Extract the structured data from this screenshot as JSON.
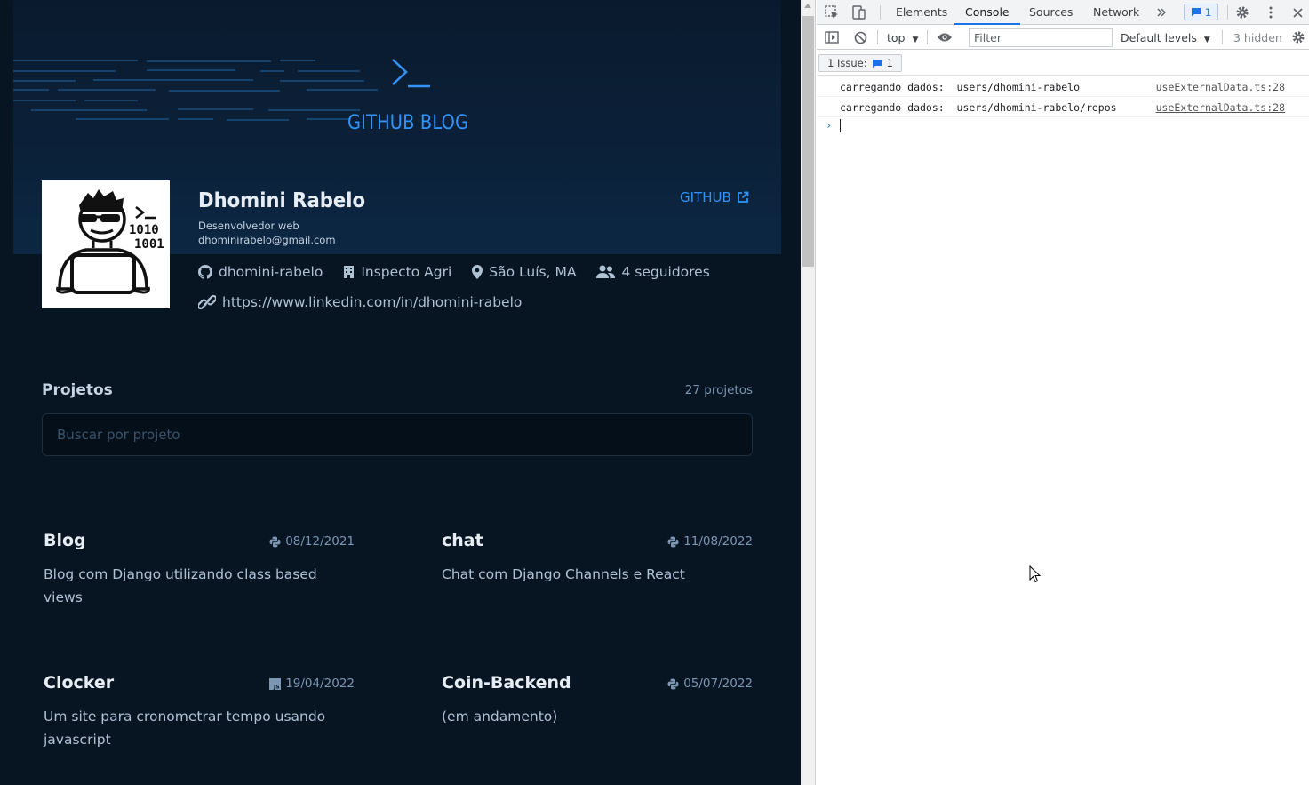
{
  "blog": {
    "logo_text": "GITHUB BLOG",
    "profile": {
      "name": "Dhomini Rabelo",
      "role": "Desenvolvedor web",
      "email": "dhominirabelo@gmail.com",
      "github_label": "GITHUB",
      "username": "dhomini-rabelo",
      "company": "Inspecto Agri",
      "location": "São Luís, MA",
      "followers": "4 seguidores",
      "website": "https://www.linkedin.com/in/dhomini-rabelo"
    },
    "projects": {
      "title": "Projetos",
      "count": "27 projetos",
      "search_placeholder": "Buscar por projeto"
    },
    "posts": [
      {
        "title": "Blog",
        "date": "08/12/2021",
        "icon": "python-icon",
        "description": "Blog com Django utilizando class based views"
      },
      {
        "title": "chat",
        "date": "11/08/2022",
        "icon": "python-icon",
        "description": "Chat com Django Channels e React"
      },
      {
        "title": "Clocker",
        "date": "19/04/2022",
        "icon": "javascript-icon",
        "description": "Um site para cronometrar tempo usando javascript"
      },
      {
        "title": "Coin-Backend",
        "date": "05/07/2022",
        "icon": "python-icon",
        "description": "(em andamento)"
      }
    ]
  },
  "devtools": {
    "tabs": [
      "Elements",
      "Console",
      "Sources",
      "Network"
    ],
    "active_tab": "Console",
    "issues_badge": "1",
    "context": "top",
    "filter_placeholder": "Filter",
    "levels": "Default levels",
    "hidden": "3 hidden",
    "issues_label": "1 Issue:",
    "issues_count": "1",
    "messages": [
      {
        "text": "carregando dados:  users/dhomini-rabelo",
        "source": "useExternalData.ts:28"
      },
      {
        "text": "carregando dados:  users/dhomini-rabelo/repos",
        "source": "useExternalData.ts:28"
      }
    ]
  },
  "colors": {
    "accent": "#3294f8",
    "background": "#071422",
    "hero": "#0b2038",
    "devtools_accent": "#1a73e8"
  }
}
